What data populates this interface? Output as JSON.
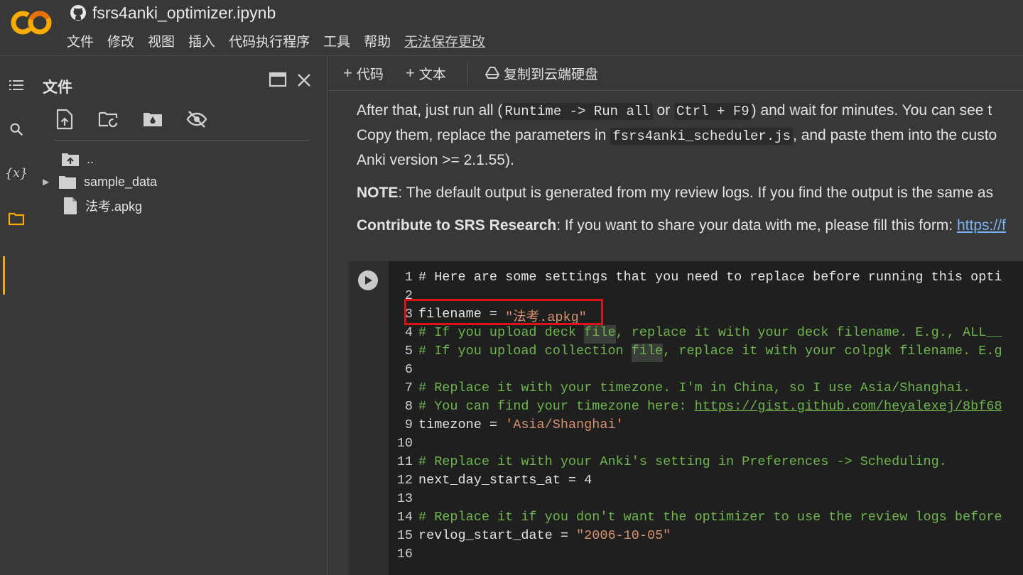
{
  "app": {
    "title": "fsrs4anki_optimizer.ipynb",
    "menu": [
      "文件",
      "修改",
      "视图",
      "插入",
      "代码执行程序",
      "工具",
      "帮助"
    ],
    "unsaved_notice": "无法保存更改"
  },
  "filepanel": {
    "title": "文件",
    "tree": [
      {
        "label": "..",
        "icon": "folder-up-icon"
      },
      {
        "label": "sample_data",
        "icon": "folder-icon"
      },
      {
        "label": "法考.apkg",
        "icon": "file-icon"
      }
    ]
  },
  "toolbar": {
    "add_code": "代码",
    "add_text": "文本",
    "copy_drive": "复制到云端硬盘"
  },
  "markdown": {
    "p1": {
      "a": "After that, just run all (",
      "code1": "Runtime -> Run all",
      "b": " or ",
      "code2": "Ctrl + F9",
      "c": ") and wait for minutes. You can see t"
    },
    "p2": {
      "a": "Copy them, replace the parameters in ",
      "code": "fsrs4anki_scheduler.js",
      "b": ", and paste them into the custo"
    },
    "p3": "Anki version >= 2.1.55).",
    "note_label": "NOTE",
    "note_text": ": The default output is generated from my review logs. If you find the output is the same as",
    "contrib_label": "Contribute to SRS Research",
    "contrib_text": ": If you want to share your data with me, please fill this form: ",
    "contrib_link": "https://f"
  },
  "code": {
    "l1": "# Here are some settings that you need to replace before running this opti",
    "l3_var": "filename = ",
    "l3_val": "\"法考.apkg\"",
    "l4a": "# If you upload deck ",
    "l4hl": "file",
    "l4b": ", replace it with your deck filename. E.g., ALL__",
    "l5a": "# If you upload collection ",
    "l5hl": "file",
    "l5b": ", replace it with your colpgk filename. E.g",
    "l7": "# Replace it with your timezone. I'm in China, so I use Asia/Shanghai.",
    "l8a": "# You can find your timezone here: ",
    "l8link": "https://gist.github.com/heyalexej/8bf68",
    "l9_var": "timezone = ",
    "l9_val": "'Asia/Shanghai'",
    "l11": "# Replace it with your Anki's setting in Preferences -> Scheduling.",
    "l12_var": "next_day_starts_at = ",
    "l12_val": "4",
    "l14": "# Replace it if you don't want the optimizer to use the review logs before",
    "l15_var": "revlog_start_date = ",
    "l15_val": "\"2006-10-05\"",
    "line_numbers": [
      "1",
      "2",
      "3",
      "4",
      "5",
      "6",
      "7",
      "8",
      "9",
      "10",
      "11",
      "12",
      "13",
      "14",
      "15",
      "16"
    ]
  },
  "colors": {
    "accent": "#f9ab00",
    "comment": "#6fb54e",
    "string": "#d89070",
    "highlight_box": "#e0101a"
  }
}
